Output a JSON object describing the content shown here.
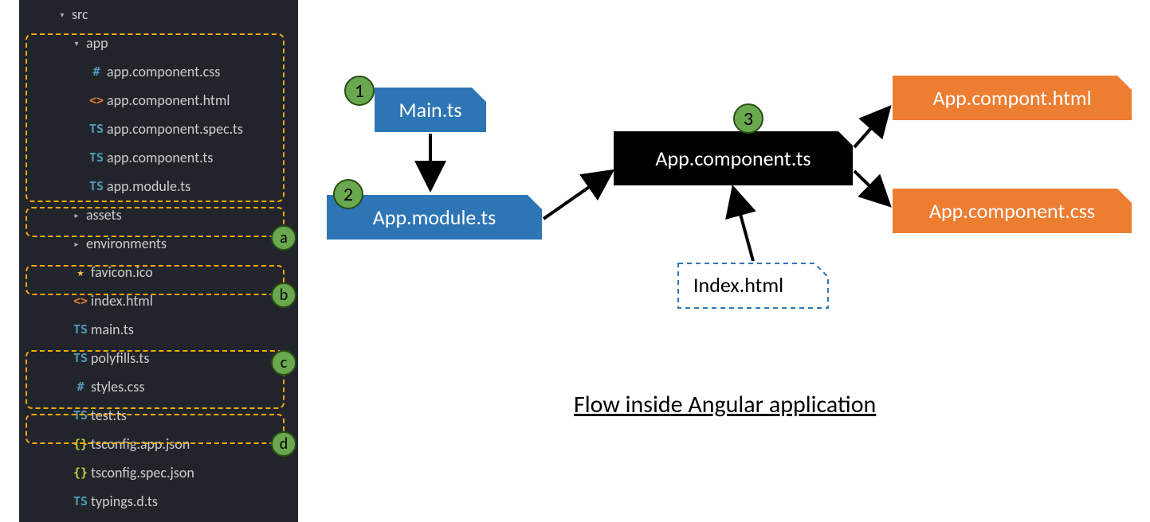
{
  "tree": {
    "src": "src",
    "app": "app",
    "files": {
      "app_comp_css": "app.component.css",
      "app_comp_html": "app.component.html",
      "app_comp_spec_ts": "app.component.spec.ts",
      "app_comp_ts": "app.component.ts",
      "app_module_ts": "app.module.ts",
      "assets": "assets",
      "environments": "environments",
      "favicon": "favicon.ico",
      "index_html": "index.html",
      "main_ts": "main.ts",
      "polyfills_ts": "polyfills.ts",
      "styles_css": "styles.css",
      "test_ts": "test.ts",
      "tsconfig_app": "tsconfig.app.json",
      "tsconfig_spec": "tsconfig.spec.json",
      "typings": "typings.d.ts"
    }
  },
  "letters": {
    "a": "a",
    "b": "b",
    "c": "c",
    "d": "d"
  },
  "numbers": {
    "n1": "1",
    "n2": "2",
    "n3": "3"
  },
  "flow": {
    "main_ts": "Main.ts",
    "app_module_ts": "App.module.ts",
    "app_component_ts": "App.component.ts",
    "index_html": "Index.html",
    "app_component_html": "App.compont.html",
    "app_component_css": "App.component.css"
  },
  "caption": "Flow inside Angular application"
}
